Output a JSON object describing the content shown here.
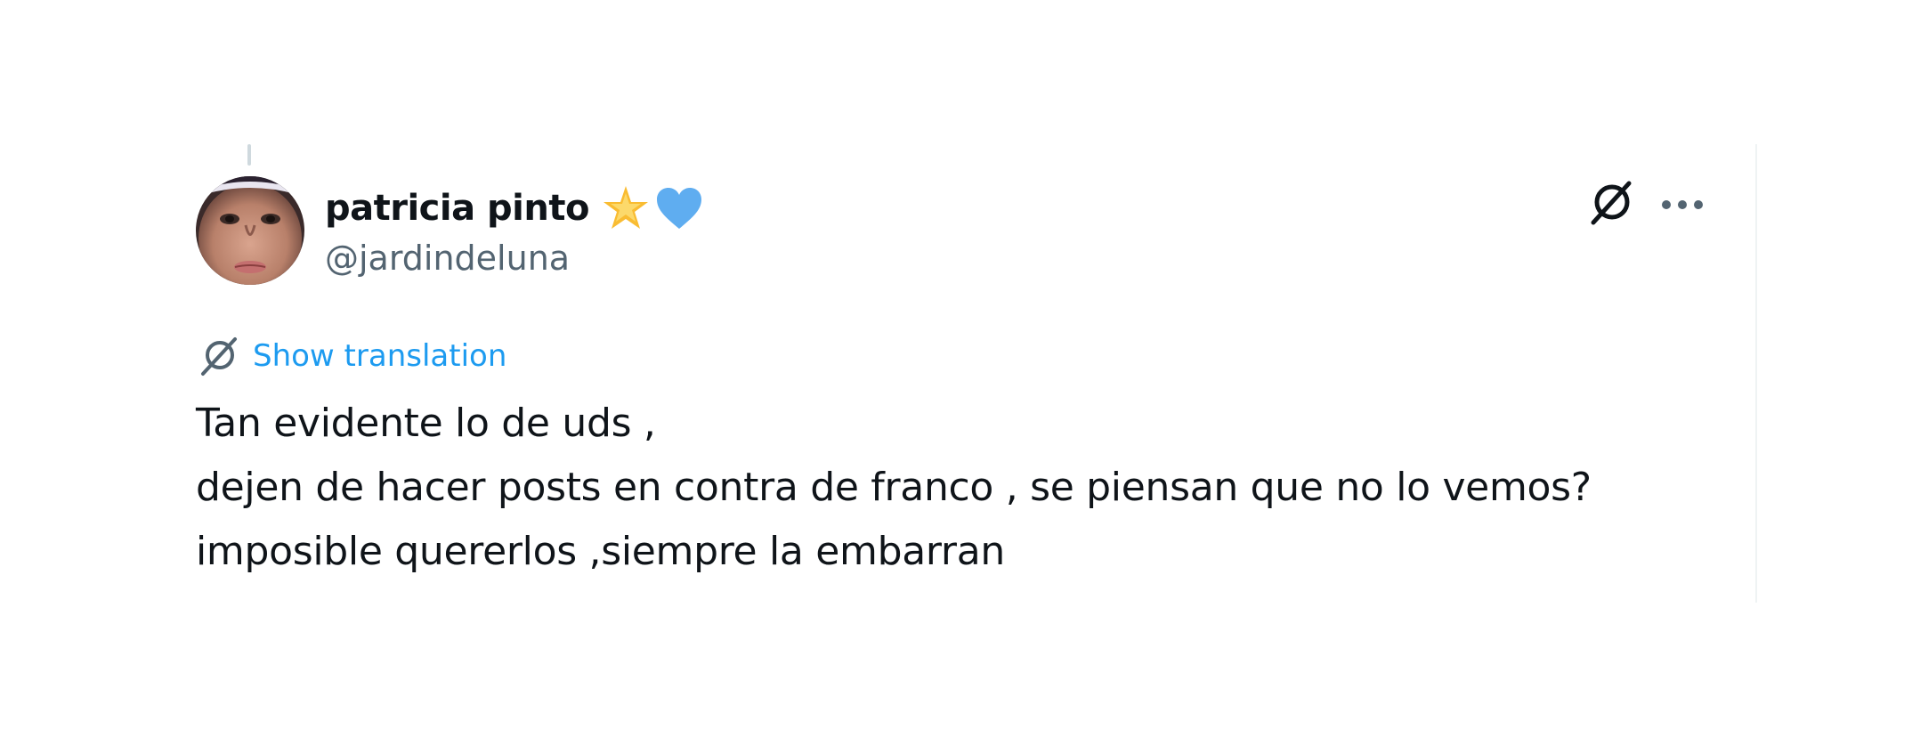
{
  "tweet": {
    "author": {
      "display_name": "patricia pinto",
      "handle": "@jardindeluna",
      "name_emojis": [
        "star-emoji",
        "blue-heart-emoji"
      ]
    },
    "actions": {
      "grok_icon": "grok-icon",
      "more_icon": "more-icon"
    },
    "translation": {
      "icon": "translate-icon",
      "label": "Show translation"
    },
    "text_lines": [
      "Tan evidente lo de uds ,",
      "dejen de hacer posts en contra de franco , se piensan que no lo vemos?",
      "imposible quererlos ,siempre la embarran"
    ]
  },
  "colors": {
    "text_primary": "#0f1419",
    "text_secondary": "#536471",
    "link_blue": "#1d9bf0",
    "heart_blue": "#5fadf0",
    "star_yellow": "#f9bc32",
    "divider": "#eff3f4"
  }
}
